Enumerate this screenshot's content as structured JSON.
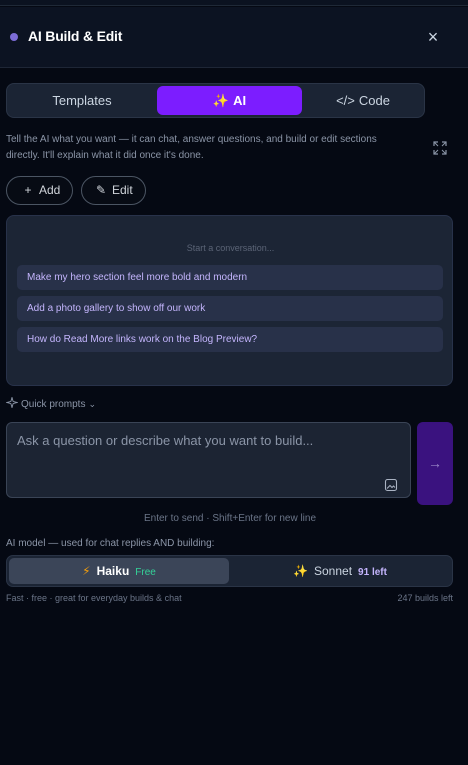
{
  "header": {
    "title": "AI Build & Edit",
    "close_glyph": "×",
    "accent_dot": "#7c6cd6"
  },
  "tabs": [
    {
      "label": "Templates",
      "icon": ""
    },
    {
      "label": "AI",
      "icon": "✨",
      "active": true
    },
    {
      "label": "Code",
      "icon": "</>"
    }
  ],
  "description": "Tell the AI what you want — it can chat, answer questions, and build or edit sections directly. It'll explain what it did once it's done.",
  "actions": {
    "add": {
      "icon": "+",
      "label": "Add"
    },
    "edit": {
      "icon": "✎",
      "label": "Edit"
    }
  },
  "chat": {
    "empty_text": "Start a conversation...",
    "suggestions": [
      "Make my hero section feel more bold and modern",
      "Add a photo gallery to show off our work",
      "How do Read More links work on the Blog Preview?"
    ]
  },
  "quick_prompts": {
    "label": "Quick prompts",
    "icon": "sparkle-icon",
    "chevron": "⌄"
  },
  "composer": {
    "value": "",
    "placeholder": "Ask a question or describe what you want to build...",
    "send_glyph": "→"
  },
  "hint": "Enter to send · Shift+Enter for new line",
  "model_section": {
    "label": "AI model — used for chat replies AND building:",
    "models": [
      {
        "icon": "⚡",
        "name": "Haiku",
        "badge": "Free",
        "selected": true
      },
      {
        "icon": "✨",
        "name": "Sonnet",
        "badge": "91 left",
        "selected": false
      }
    ],
    "footer_left": "Fast · free · great for everyday builds & chat",
    "footer_right": "247 builds left"
  },
  "colors": {
    "accent": "#7c1dff",
    "background": "#050913",
    "panel": "#1c2535",
    "free_badge": "#34d399"
  }
}
